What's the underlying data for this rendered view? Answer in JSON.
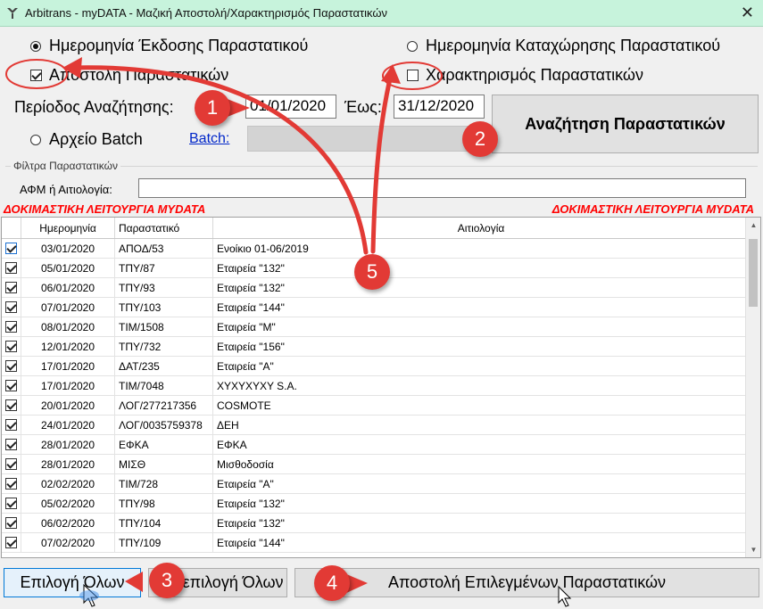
{
  "window": {
    "title": "Arbitrans - myDATA - Μαζική Αποστολή/Χαρακτηρισμός Παραστατικών"
  },
  "options": {
    "issue_date_label": "Ημερομηνία Έκδοσης Παραστατικού",
    "register_date_label": "Ημερομηνία Καταχώρησης Παραστατικού",
    "send_label": "Αποστολή Παραστατικών",
    "characterize_label": "Χαρακτηρισμός Παραστατικών"
  },
  "period": {
    "label": "Περίοδος Αναζήτησης:",
    "from_value": "01/01/2020",
    "to_label": "Έως:",
    "to_value": "31/12/2020"
  },
  "batch": {
    "radio_label": "Αρχείο Batch",
    "link_label": "Batch:"
  },
  "search_button": "Αναζήτηση Παραστατικών",
  "filters": {
    "legend": "Φίλτρα Παραστατικών",
    "afm_label": "ΑΦΜ ή Αιτιολογία:",
    "afm_value": ""
  },
  "warning": "ΔΟΚΙΜΑΣΤΙΚΗ ΛΕΙΤΟΥΡΓΙΑ MYDATA",
  "table": {
    "columns": [
      "Ημερομηνία",
      "Παραστατικό",
      "Αιτιολογία"
    ],
    "rows": [
      [
        "03/01/2020",
        "ΑΠΟΔ/53",
        "Ενοίκιο 01-06/2019"
      ],
      [
        "05/01/2020",
        "ΤΠΥ/87",
        "Εταιρεία \"132\""
      ],
      [
        "06/01/2020",
        "ΤΠΥ/93",
        "Εταιρεία \"132\""
      ],
      [
        "07/01/2020",
        "ΤΠΥ/103",
        "Εταιρεία \"144\""
      ],
      [
        "08/01/2020",
        "ΤΙΜ/1508",
        "Εταιρεία \"Μ\""
      ],
      [
        "12/01/2020",
        "ΤΠΥ/732",
        "Εταιρεία \"156\""
      ],
      [
        "17/01/2020",
        "ΔΑΤ/235",
        "Εταιρεία \"Α\""
      ],
      [
        "17/01/2020",
        "ΤΙΜ/7048",
        "XYXYXYXY S.A."
      ],
      [
        "20/01/2020",
        "ΛΟΓ/277217356",
        "COSMOTE"
      ],
      [
        "24/01/2020",
        "ΛΟΓ/0035759378",
        "ΔΕΗ"
      ],
      [
        "28/01/2020",
        "ΕΦΚΑ",
        "ΕΦΚΑ"
      ],
      [
        "28/01/2020",
        "ΜΙΣΘ",
        "Μισθοδοσία"
      ],
      [
        "02/02/2020",
        "ΤΙΜ/728",
        "Εταιρεία \"Α\""
      ],
      [
        "05/02/2020",
        "ΤΠΥ/98",
        "Εταιρεία \"132\""
      ],
      [
        "06/02/2020",
        "ΤΠΥ/104",
        "Εταιρεία \"132\""
      ],
      [
        "07/02/2020",
        "ΤΠΥ/109",
        "Εταιρεία \"144\""
      ]
    ]
  },
  "buttons": {
    "select_all": "Επιλογή Όλων",
    "deselect_all": "Αποεπιλογή Όλων",
    "send_selected": "Αποστολή Επιλεγμένων Παραστατικών"
  },
  "callouts": [
    "1",
    "2",
    "3",
    "4",
    "5"
  ],
  "colors": {
    "titlebar": "#c7f3dc",
    "warning": "#ff0000",
    "callout": "#e23a35",
    "link": "#0026c9"
  }
}
